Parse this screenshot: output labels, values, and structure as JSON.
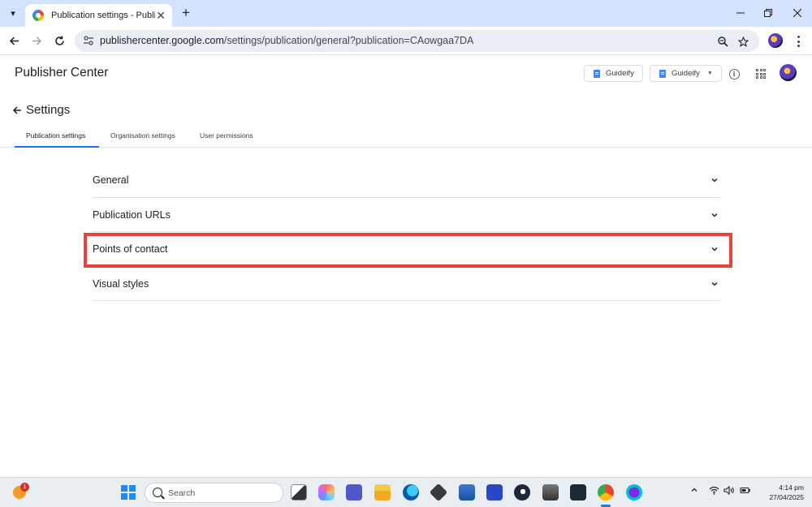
{
  "browser": {
    "tab_title": "Publication settings - Publisher Center",
    "url_host": "publishercenter.google.com",
    "url_path": "/settings/publication/general?publication=CAowgaa7DA",
    "new_tab_symbol": "+",
    "close_symbol": "✕"
  },
  "header": {
    "brand": "Publisher Center",
    "publication_button": "Guideify",
    "publication_select": "Guideify"
  },
  "settings": {
    "title": "Settings",
    "tabs": [
      {
        "label": "Publication settings",
        "active": true
      },
      {
        "label": "Organisation settings",
        "active": false
      },
      {
        "label": "User permissions",
        "active": false
      }
    ],
    "sections": [
      {
        "label": "General"
      },
      {
        "label": "Publication URLs"
      },
      {
        "label": "Points of contact",
        "highlighted": true
      },
      {
        "label": "Visual styles"
      }
    ]
  },
  "taskbar": {
    "search_placeholder": "Search",
    "notification_count": "1",
    "time": "4:14 pm",
    "date": "27/04/2025",
    "apps": [
      "file-explorer-icon",
      "copilot-icon",
      "teams-icon",
      "folder-icon",
      "edge-icon",
      "blackbox-icon",
      "store-icon",
      "vscode-like-icon",
      "steam-icon",
      "wifi-analyzer-icon",
      "terminal-icon",
      "chrome-icon",
      "canva-icon"
    ]
  },
  "colors": {
    "accent": "#1a73e8",
    "highlight_border": "#e8433b",
    "tabstrip": "#d3e3fd"
  }
}
